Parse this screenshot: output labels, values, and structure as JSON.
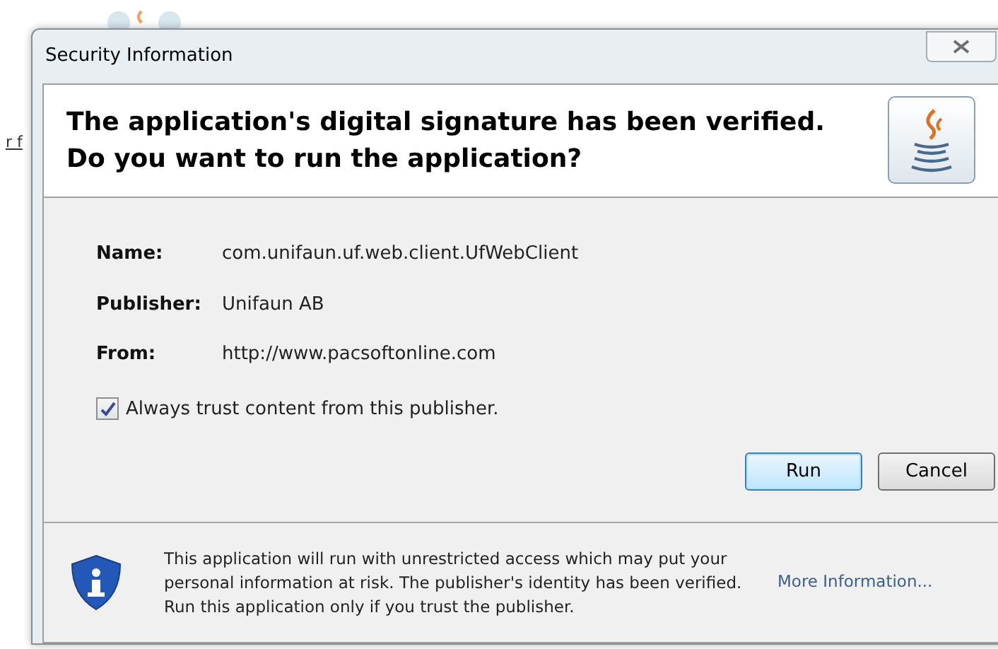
{
  "background": {
    "link_fragment": "r f"
  },
  "window": {
    "title": "Security Information"
  },
  "header": {
    "lines": [
      "The application's digital signature has been verified.",
      "Do you want to run the application?"
    ]
  },
  "details": [
    {
      "label": "Name:",
      "value": "com.unifaun.uf.web.client.UfWebClient"
    },
    {
      "label": "Publisher:",
      "value": "Unifaun AB"
    },
    {
      "label": "From:",
      "value": "http://www.pacsoftonline.com"
    }
  ],
  "trust_checkbox": {
    "label": "Always trust content from this publisher.",
    "checked": true
  },
  "buttons": [
    {
      "label": "Run",
      "default": true
    },
    {
      "label": "Cancel",
      "default": false
    }
  ],
  "footer": {
    "message": "This application will run with unrestricted access which may put your personal information at risk. The publisher's identity has been verified. Run this application only if you trust the publisher.",
    "link": "More Information..."
  }
}
